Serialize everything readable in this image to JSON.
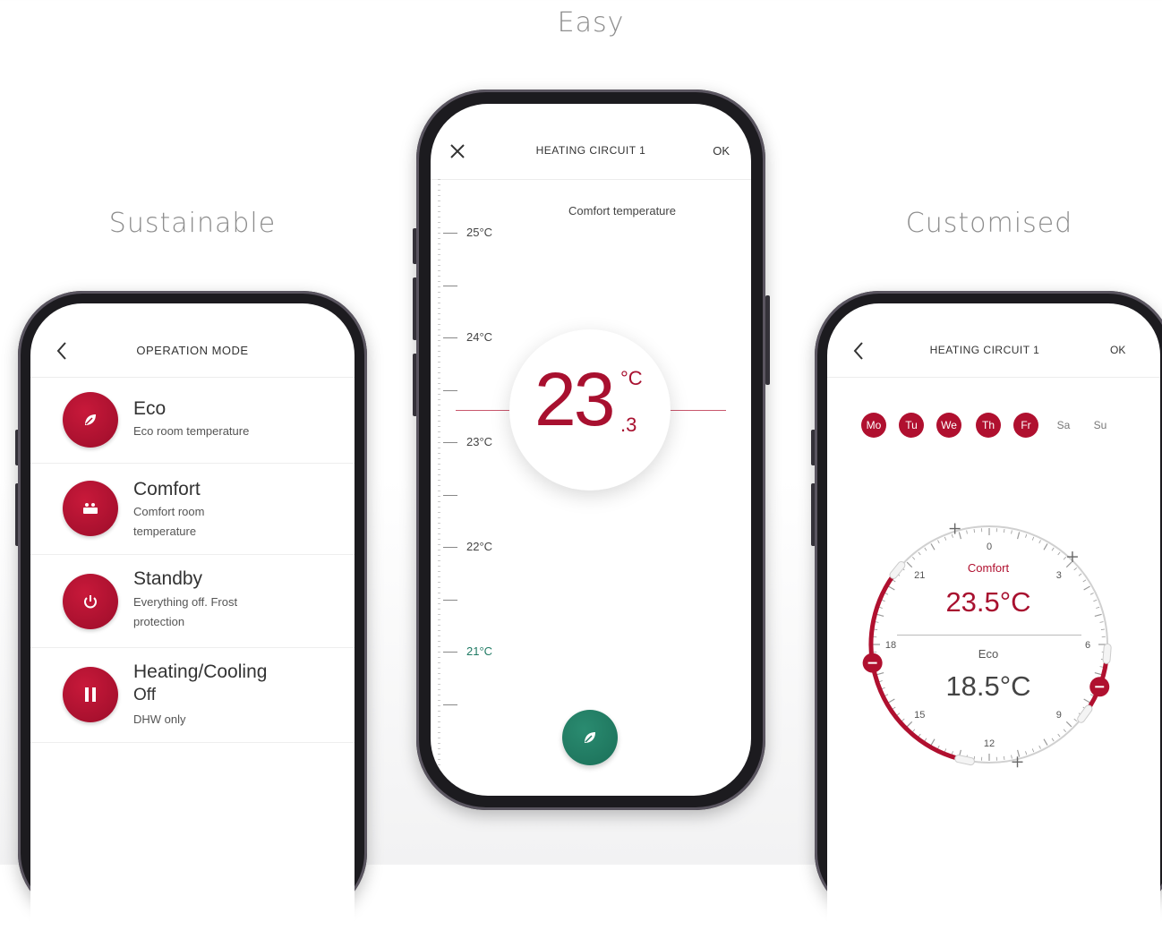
{
  "captions": {
    "left": "Sustainable",
    "center": "Easy",
    "right": "Customised"
  },
  "left_phone": {
    "back_icon": "chevron-left-icon",
    "title": "OPERATION MODE",
    "modes": [
      {
        "icon": "leaf-icon",
        "title": "Eco",
        "subtitle": "Eco room temperature",
        "subtitle2": ""
      },
      {
        "icon": "comfort-icon",
        "title": "Comfort",
        "subtitle": "Comfort room",
        "subtitle2": "temperature"
      },
      {
        "icon": "power-icon",
        "title": "Standby",
        "subtitle": "Everything off. Frost",
        "subtitle2": "protection"
      },
      {
        "icon": "pause-icon",
        "title": "Heating/Cooling",
        "title2": "Off",
        "subtitle": "DHW only",
        "subtitle2": ""
      }
    ]
  },
  "center_phone": {
    "close_icon": "close-icon",
    "title": "HEATING CIRCUIT 1",
    "ok": "OK",
    "subtitle": "Comfort temperature",
    "scale_labels": [
      "25°C",
      "24°C",
      "23°C",
      "22°C",
      "21°C"
    ],
    "temp_whole": "23",
    "temp_unit": "°C",
    "temp_decimal": ".3",
    "eco_button_icon": "leaf-icon",
    "accent": "#b0102f",
    "eco_color": "#1f7a63"
  },
  "right_phone": {
    "back_icon": "chevron-left-icon",
    "title": "HEATING CIRCUIT 1",
    "ok": "OK",
    "days": [
      {
        "label": "Mo",
        "active": true
      },
      {
        "label": "Tu",
        "active": true
      },
      {
        "label": "We",
        "active": true
      },
      {
        "label": "Th",
        "active": true
      },
      {
        "label": "Fr",
        "active": true
      },
      {
        "label": "Sa",
        "active": false
      },
      {
        "label": "Su",
        "active": false
      }
    ],
    "dial_hours": [
      "0",
      "3",
      "6",
      "9",
      "12",
      "15",
      "18",
      "21"
    ],
    "comfort_label": "Comfort",
    "comfort_temp": "23.5°C",
    "eco_label": "Eco",
    "eco_temp": "18.5°C"
  }
}
